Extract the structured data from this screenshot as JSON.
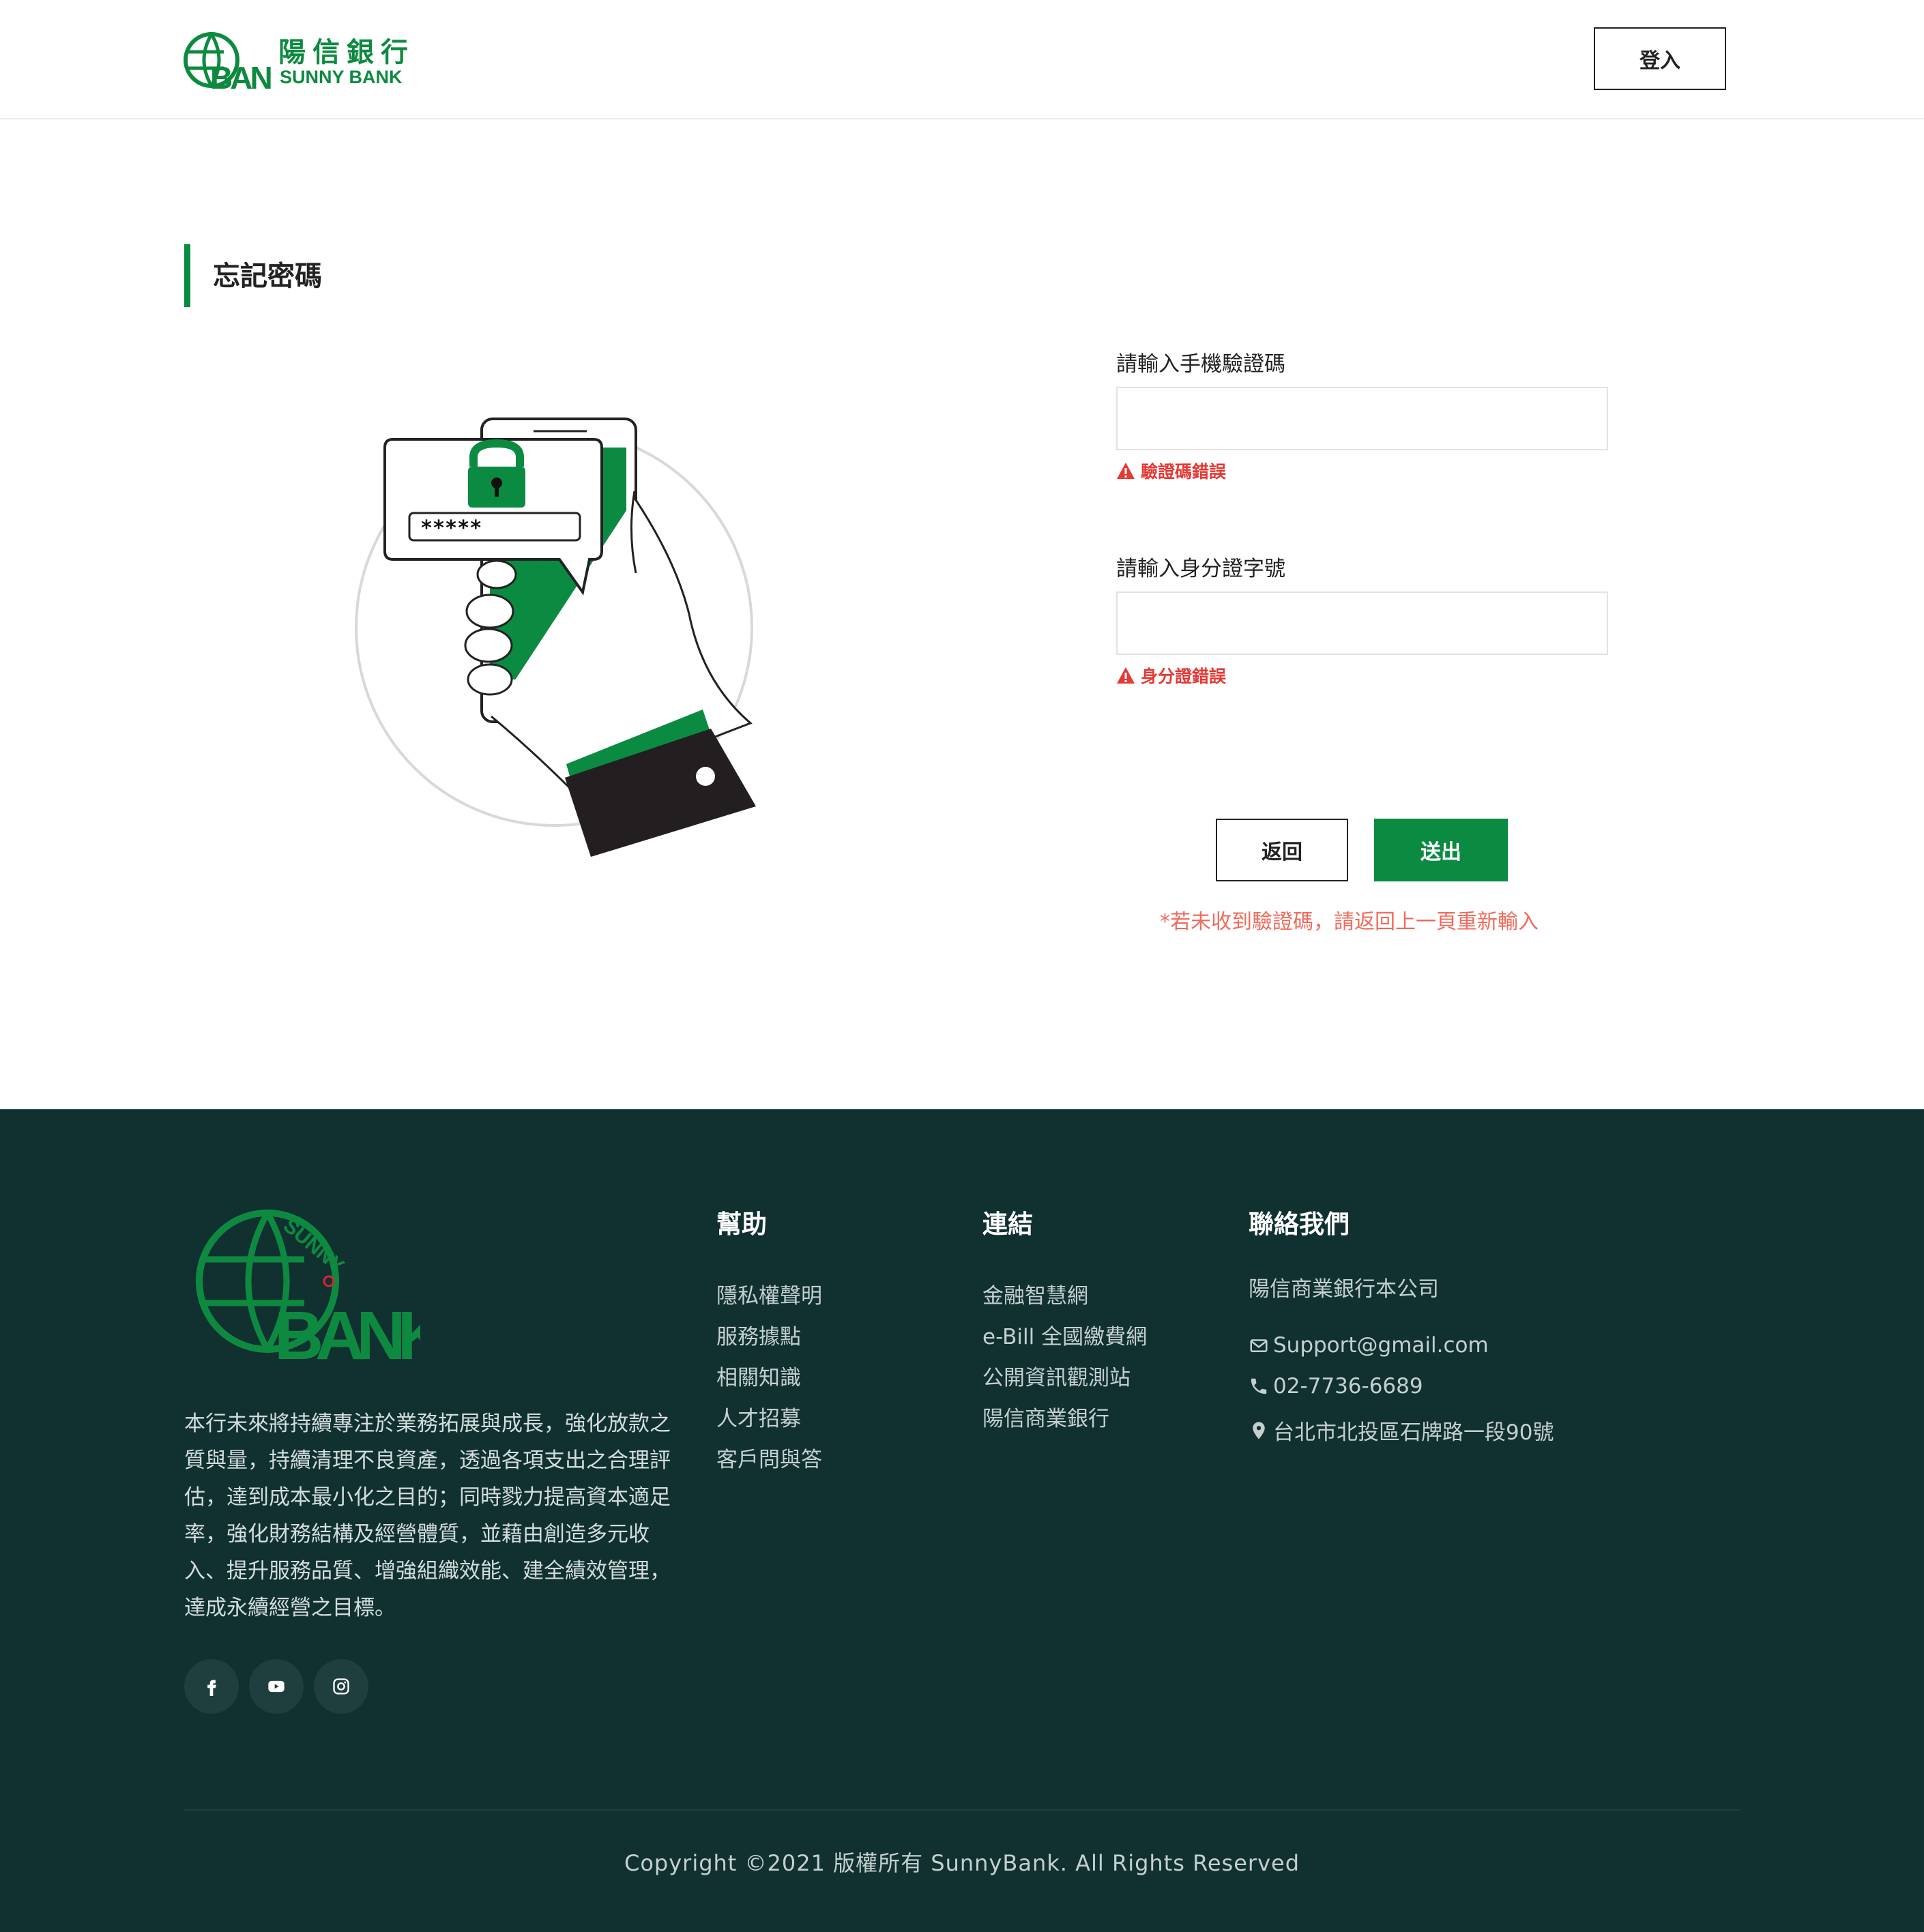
{
  "brand": {
    "name_cn": "陽信銀行",
    "name_en": "SUNNY BANK",
    "logo_arc_text": "SUNNY",
    "logo_letters": "BANK",
    "colors": {
      "primary": "#0b8a42",
      "footer_bg": "#113131",
      "error": "#e53935",
      "notice": "#f06a5a"
    }
  },
  "header": {
    "login_label": "登入"
  },
  "page": {
    "title": "忘記密碼",
    "illustration_password": "*****"
  },
  "form": {
    "sms": {
      "label": "請輸入手機驗證碼",
      "value": "",
      "error": "驗證碼錯誤"
    },
    "id": {
      "label": "請輸入身分證字號",
      "value": "",
      "error": "身分證錯誤"
    },
    "back_label": "返回",
    "submit_label": "送出",
    "notice": "*若未收到驗證碼，請返回上一頁重新輸入"
  },
  "footer": {
    "about": "本行未來將持續專注於業務拓展與成長，強化放款之質與量，持續清理不良資產，透過各項支出之合理評估，達到成本最小化之目的；同時戮力提高資本適足率，強化財務結構及經營體質，並藉由創造多元收入、提升服務品質、增強組織效能、建全績效管理，達成永續經營之目標。",
    "social": [
      "facebook-icon",
      "youtube-icon",
      "instagram-icon"
    ],
    "help": {
      "heading": "幫助",
      "items": [
        "隱私權聲明",
        "服務據點",
        "相關知識",
        "人才招募",
        "客戶問與答"
      ]
    },
    "links": {
      "heading": "連結",
      "items": [
        "金融智慧網",
        "e-Bill 全國繳費網",
        "公開資訊觀測站",
        "陽信商業銀行"
      ]
    },
    "contact": {
      "heading": "聯絡我們",
      "company": "陽信商業銀行本公司",
      "email": "Support@gmail.com",
      "phone": "02-7736-6689",
      "address": "台北市北投區石牌路一段90號"
    },
    "copyright": "Copyright ©2021 版權所有 SunnyBank. All Rights Reserved"
  }
}
